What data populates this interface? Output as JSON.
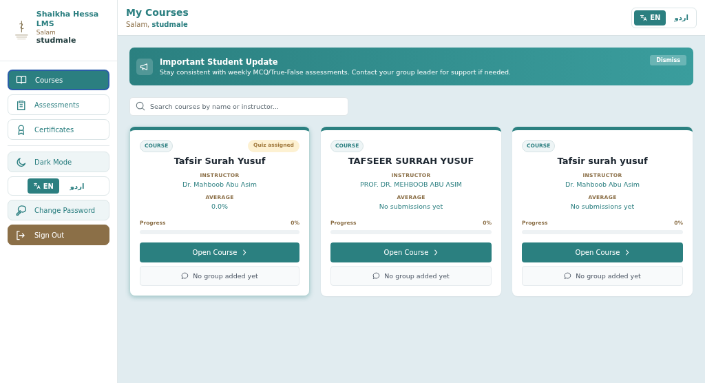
{
  "sidebar": {
    "brand": {
      "name": "Shaikha Hessa LMS",
      "greeting": "Salam",
      "user": "studmale"
    },
    "nav": [
      {
        "label": "Courses",
        "selected": true
      },
      {
        "label": "Assessments",
        "selected": false
      },
      {
        "label": "Certificates",
        "selected": false
      }
    ],
    "actions": [
      {
        "kind": "toggle",
        "label": "Dark Mode"
      },
      {
        "kind": "language",
        "options": [
          {
            "label": "EN",
            "selected": true
          },
          {
            "label": "اردو",
            "selected": false
          }
        ]
      },
      {
        "kind": "button",
        "label": "Change Password"
      },
      {
        "kind": "danger",
        "label": "Sign Out"
      }
    ]
  },
  "header": {
    "title": "My Courses",
    "greeting": "Salam,",
    "user": "studmale",
    "language": [
      {
        "label": "EN",
        "selected": true
      },
      {
        "label": "اردو",
        "selected": false
      }
    ]
  },
  "banner": {
    "title": "Important Student Update",
    "message": "Stay consistent with weekly MCQ/True-False assessments. Contact your group leader for support if needed.",
    "dismiss": "Dismiss"
  },
  "search": {
    "placeholder": "Search courses by name or instructor..."
  },
  "courses": [
    {
      "tag": "COURSE",
      "badge": "Quiz assigned",
      "title": "Tafsir Surah Yusuf",
      "instructor_label": "INSTRUCTOR",
      "instructor": "Dr. Mahboob Abu Asim",
      "average_label": "AVERAGE",
      "average": "0.0%",
      "progress_label": "Progress",
      "progress_value": "0%",
      "open": "Open Course",
      "group": "No group added yet",
      "highlighted": true
    },
    {
      "tag": "COURSE",
      "title": "TAFSEER SURRAH YUSUF",
      "instructor_label": "INSTRUCTOR",
      "instructor": "PROF. DR. MEHBOOB ABU ASIM",
      "average_label": "AVERAGE",
      "average": "No submissions yet",
      "progress_label": "Progress",
      "progress_value": "0%",
      "open": "Open Course",
      "group": "No group added yet",
      "highlighted": false
    },
    {
      "tag": "COURSE",
      "title": "Tafsir surah yusuf",
      "instructor_label": "INSTRUCTOR",
      "instructor": "Dr. Mahboob Abu Asim",
      "average_label": "AVERAGE",
      "average": "No submissions yet",
      "progress_label": "Progress",
      "progress_value": "0%",
      "open": "Open Course",
      "group": "No group added yet",
      "highlighted": false
    }
  ]
}
